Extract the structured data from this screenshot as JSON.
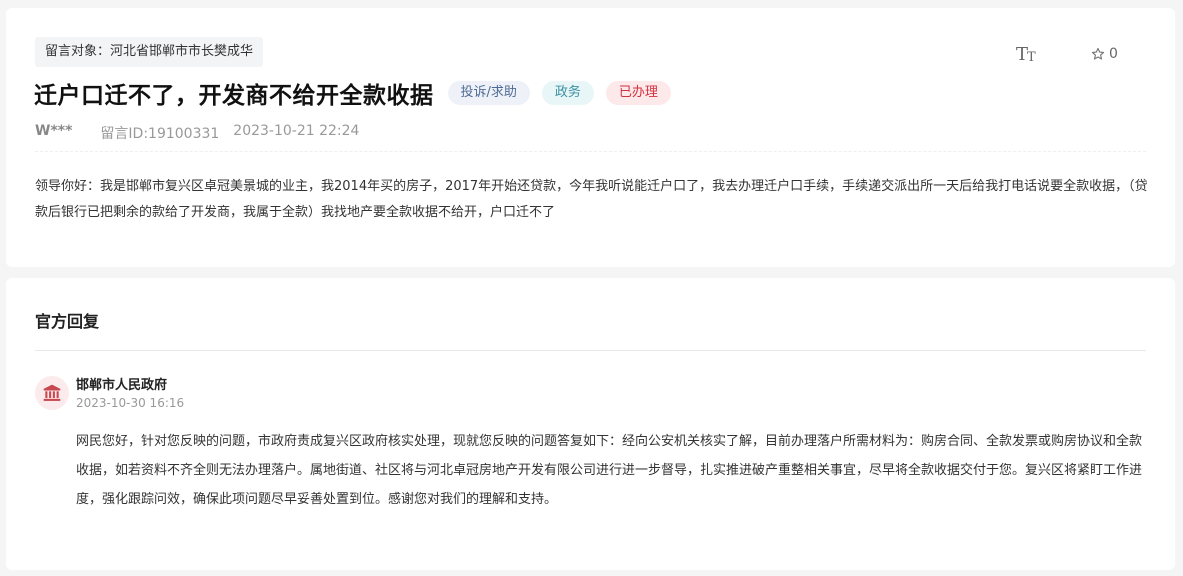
{
  "message": {
    "target_label": "留言对象：河北省邯郸市市长樊成华",
    "title": "迁户口迁不了，开发商不给开全款收据",
    "tags": {
      "type": "投诉/求助",
      "domain": "政务",
      "status": "已办理"
    },
    "author": "W***",
    "message_id": "留言ID:19100331",
    "timestamp": "2023-10-21 22:24",
    "content": "领导你好：我是邯郸市复兴区卓冠美景城的业主，我2014年买的房子，2017年开始还贷款，今年我听说能迁户口了，我去办理迁户口手续，手续递交派出所一天后给我打电话说要全款收据，（贷款后银行已把剩余的款给了开发商，我属于全款）我找地产要全款收据不给开，户口迁不了",
    "font_size_toggle": {
      "big": "T",
      "small": "T",
      "icon": "font-size-icon"
    },
    "favorite": {
      "icon": "star-outline-icon",
      "count": "0"
    }
  },
  "reply": {
    "heading": "官方回复",
    "responder": "邯郸市人民政府",
    "responder_icon": "government-building-icon",
    "timestamp": "2023-10-30 16:16",
    "content": "网民您好，针对您反映的问题，市政府责成复兴区政府核实处理，现就您反映的问题答复如下：经向公安机关核实了解，目前办理落户所需材料为：购房合同、全款发票或购房协议和全款收据，如若资料不齐全则无法办理落户。属地街道、社区将与河北卓冠房地产开发有限公司进行进一步督导，扎实推进破产重整相关事宜，尽早将全款收据交付于您。复兴区将紧盯工作进度，强化跟踪问效，确保此项问题尽早妥善处置到位。感谢您对我们的理解和支持。"
  },
  "colors": {
    "background": "#f5f5f5",
    "status_red": "#d1313f",
    "type_blue": "#4f6b95",
    "domain_teal": "#3d8fa3",
    "gov_icon_red": "#c9474f"
  }
}
